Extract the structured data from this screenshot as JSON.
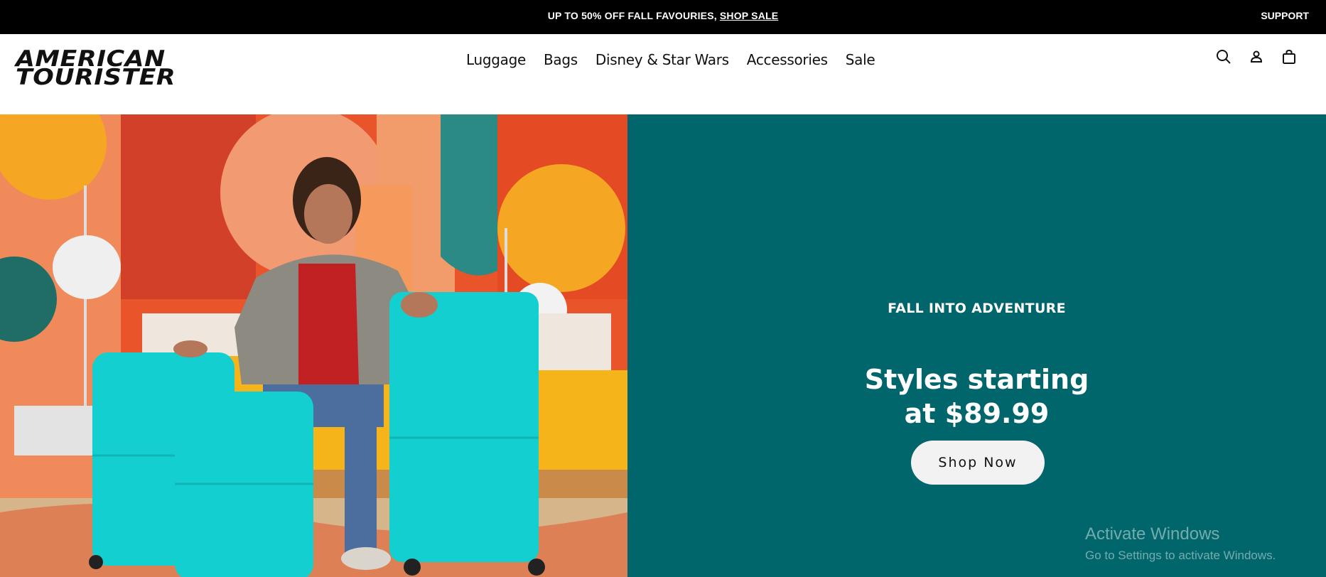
{
  "promo": {
    "text": "UP TO 50% OFF FALL FAVOURIES,",
    "link": "SHOP SALE",
    "support": "SUPPORT"
  },
  "header": {
    "logo_line1": "AMERICAN",
    "logo_line2": "TOURISTER",
    "nav": [
      "Luggage",
      "Bags",
      "Disney & Star Wars",
      "Accessories",
      "Sale"
    ],
    "icons": [
      "search-icon",
      "account-icon",
      "bag-icon"
    ]
  },
  "hero": {
    "eyebrow": "FALL INTO ADVENTURE",
    "headline_line1": "Styles starting",
    "headline_line2": "at $89.99",
    "cta": "Shop Now",
    "panel_color": "#00666b",
    "luggage_color": "#14cfcf"
  },
  "watermark": {
    "title": "Activate Windows",
    "subtitle": "Go to Settings to activate Windows."
  }
}
